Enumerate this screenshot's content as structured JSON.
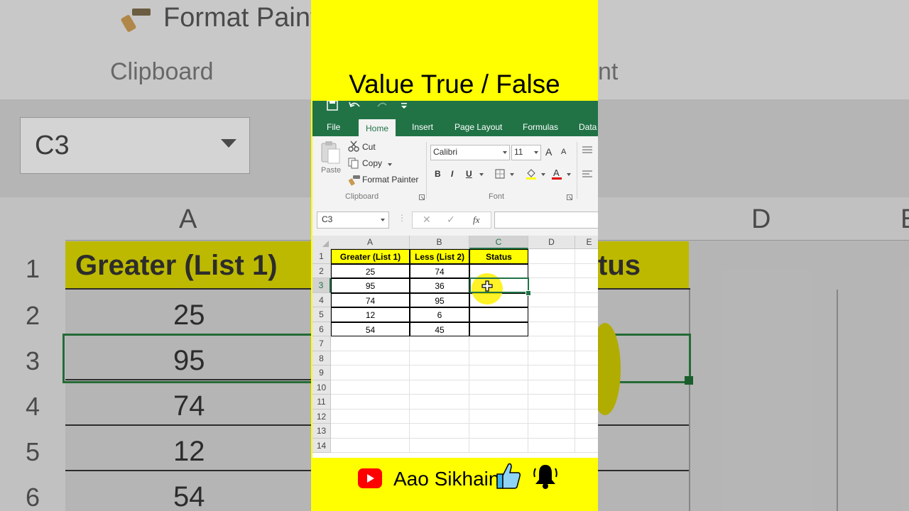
{
  "background": {
    "ribbon_text": "Format Paint",
    "clipboard_label": "Clipboard",
    "partial_label": "nt",
    "name_box": "C3",
    "columns": [
      "A",
      "D",
      "E"
    ],
    "row_numbers": [
      "1",
      "2",
      "3",
      "4",
      "5",
      "6"
    ],
    "header_cell": "Greater (List 1)",
    "header_cell_right": "tus",
    "values": [
      "25",
      "95",
      "74",
      "12",
      "54"
    ]
  },
  "overlay": {
    "title": "Value True / False",
    "brand": "Aao Sikhain"
  },
  "excel": {
    "tabs": [
      "File",
      "Home",
      "Insert",
      "Page Layout",
      "Formulas",
      "Data"
    ],
    "active_tab": "Home",
    "clipboard": {
      "paste": "Paste",
      "cut": "Cut",
      "copy": "Copy",
      "format_painter": "Format Painter",
      "group_label": "Clipboard"
    },
    "font": {
      "name": "Calibri",
      "size": "11",
      "bold": "B",
      "italic": "I",
      "underline": "U",
      "group_label": "Font",
      "grow": "A",
      "shrink": "A"
    },
    "name_box": "C3",
    "fx": "fx",
    "cancel": "✕",
    "confirm": "✓",
    "columns": [
      "A",
      "B",
      "C",
      "D",
      "E"
    ],
    "rows": [
      "1",
      "2",
      "3",
      "4",
      "5",
      "6",
      "7",
      "8",
      "9",
      "10",
      "11",
      "12",
      "13",
      "14"
    ],
    "headers": [
      "Greater (List 1)",
      "Less (List 2)",
      "Status"
    ],
    "data": [
      [
        "25",
        "74",
        ""
      ],
      [
        "95",
        "36",
        ""
      ],
      [
        "74",
        "95",
        ""
      ],
      [
        "12",
        "6",
        ""
      ],
      [
        "54",
        "45",
        ""
      ]
    ],
    "selected_cell": "C3"
  },
  "colors": {
    "excel_green": "#217346",
    "highlight_yellow": "#ffff00",
    "youtube_red": "#ff0000"
  }
}
